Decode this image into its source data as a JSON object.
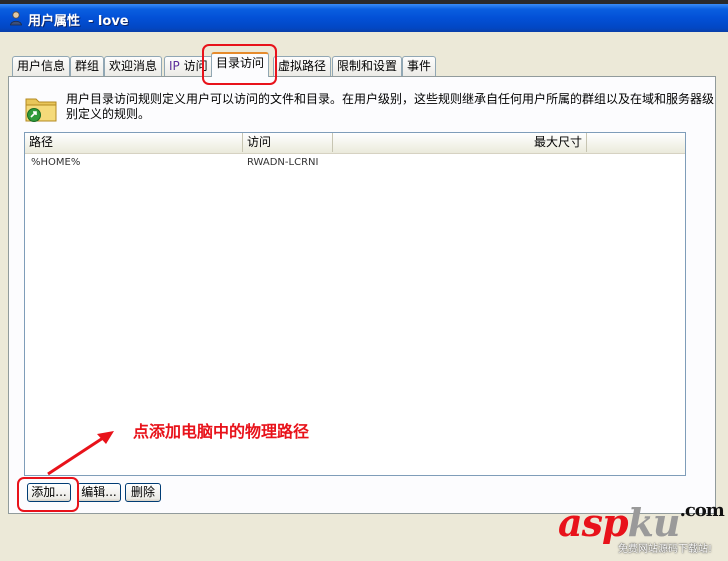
{
  "window": {
    "title": "用户属性",
    "title_user": "- love"
  },
  "tabs": [
    {
      "label": "用户信息"
    },
    {
      "label": "群组"
    },
    {
      "label": "欢迎消息"
    },
    {
      "label_prefix": "IP",
      "label": "访问"
    },
    {
      "label": "目录访问"
    },
    {
      "label": "虚拟路径"
    },
    {
      "label": "限制和设置"
    },
    {
      "label": "事件"
    }
  ],
  "panel": {
    "description": "用户目录访问规则定义用户可以访问的文件和目录。在用户级别，这些规则继承自任何用户所属的群组以及在域和服务器级别定义的规则。",
    "list": {
      "columns": [
        "路径",
        "访问",
        "最大尺寸"
      ],
      "rows": [
        {
          "path": "%HOME%",
          "access": "RWADN-LCRNI",
          "max_size": ""
        }
      ]
    },
    "buttons": {
      "add": "添加...",
      "edit": "编辑...",
      "delete": "删除"
    }
  },
  "annotation": {
    "text": "点添加电脑中的物理路径",
    "color": "#e8121a"
  },
  "watermark": {
    "logo_a": "asp",
    "logo_b": "ku",
    "logo_c": ".com",
    "subtitle": "免费网站源码下载站!"
  },
  "colors": {
    "titlebar": "#0350d6",
    "tab_active_accent": "#e68b2c",
    "annotation": "#e8121a"
  }
}
